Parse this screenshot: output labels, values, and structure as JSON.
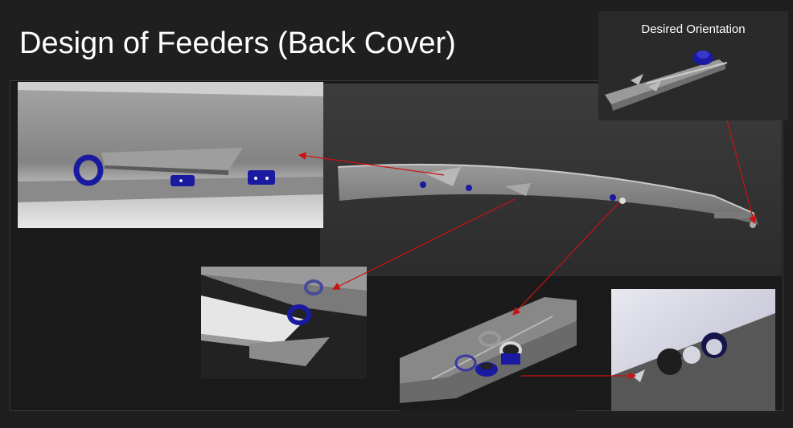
{
  "slide": {
    "title": "Design of Feeders (Back Cover)"
  },
  "inset": {
    "caption": "Desired Orientation"
  },
  "colors": {
    "background": "#1f1f1f",
    "panel_dark": "#2b2b2b",
    "metal": "#8c8c8c",
    "part_blue": "#1a1aa0",
    "arrow_red": "#cc1111"
  }
}
